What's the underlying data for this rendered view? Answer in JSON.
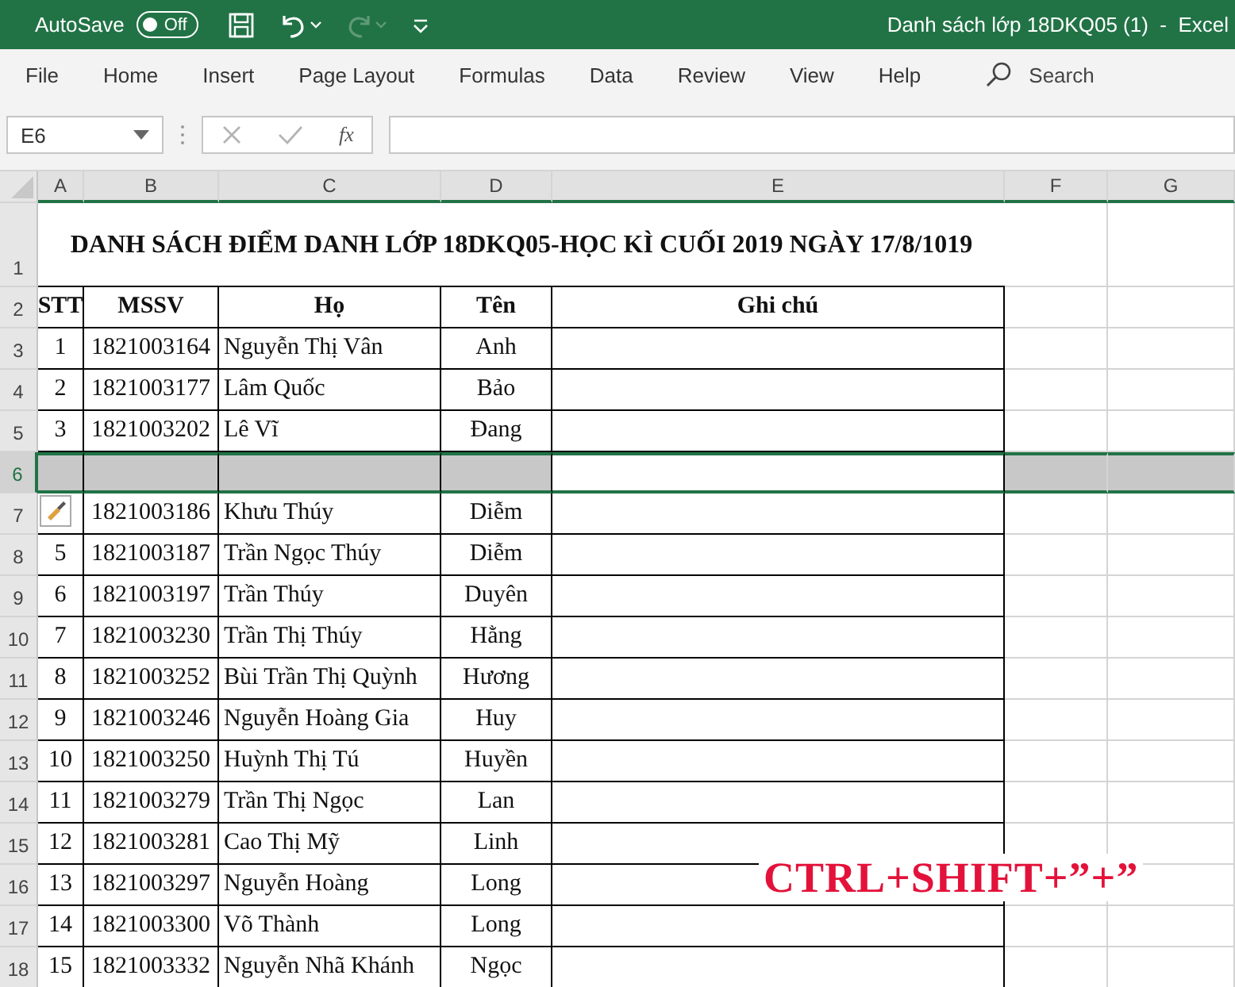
{
  "title_bar": {
    "autosave_label": "AutoSave",
    "autosave_on": false,
    "toggle_text": "Off",
    "document_title": "Danh sách lớp 18DKQ05 (1)  -  Excel",
    "redo_disabled": true
  },
  "ribbon_tabs": [
    {
      "label": "File",
      "selected": false
    },
    {
      "label": "Home",
      "selected": false
    },
    {
      "label": "Insert",
      "selected": false
    },
    {
      "label": "Page Layout",
      "selected": false
    },
    {
      "label": "Formulas",
      "selected": false
    },
    {
      "label": "Data",
      "selected": false
    },
    {
      "label": "Review",
      "selected": false
    },
    {
      "label": "View",
      "selected": false
    },
    {
      "label": "Help",
      "selected": false
    }
  ],
  "search_label": "Search",
  "formula_bar": {
    "name_box": "E6",
    "fx_label": "fx"
  },
  "sheet": {
    "columns": [
      {
        "label": "A",
        "highlighted": true,
        "active": false
      },
      {
        "label": "B",
        "highlighted": true,
        "active": false
      },
      {
        "label": "C",
        "highlighted": true,
        "active": false
      },
      {
        "label": "D",
        "highlighted": true,
        "active": false
      },
      {
        "label": "E",
        "highlighted": true,
        "active": true
      },
      {
        "label": "F",
        "highlighted": true,
        "active": false
      },
      {
        "label": "G",
        "highlighted": true,
        "active": false
      }
    ],
    "title_row": {
      "number": "1",
      "text": "DANH SÁCH ĐIỂM DANH LỚP 18DKQ05-HỌC KÌ CUỐI 2019 NGÀY 17/8/1019"
    },
    "header_row": {
      "number": "2",
      "cells": [
        "STT",
        "MSSV",
        "Họ",
        "Tên",
        "Ghi chú"
      ]
    },
    "rows": [
      {
        "number": "3",
        "stt": "1",
        "mssv": "1821003164",
        "ho": "Nguyễn Thị Vân",
        "ten": "Anh",
        "selected": false
      },
      {
        "number": "4",
        "stt": "2",
        "mssv": "1821003177",
        "ho": "Lâm Quốc",
        "ten": "Bảo",
        "selected": false
      },
      {
        "number": "5",
        "stt": "3",
        "mssv": "1821003202",
        "ho": "Lê Vĩ",
        "ten": "Đang",
        "selected": false
      },
      {
        "number": "6",
        "selected": true
      },
      {
        "number": "7",
        "paste_options": true,
        "mssv": "1821003186",
        "ho": "Khưu Thúy",
        "ten": "Diễm",
        "selected": false
      },
      {
        "number": "8",
        "stt": "5",
        "mssv": "1821003187",
        "ho": "Trần Ngọc Thúy",
        "ten": "Diễm",
        "selected": false
      },
      {
        "number": "9",
        "stt": "6",
        "mssv": "1821003197",
        "ho": "Trần Thúy",
        "ten": "Duyên",
        "selected": false
      },
      {
        "number": "10",
        "stt": "7",
        "mssv": "1821003230",
        "ho": "Trần Thị Thúy",
        "ten": "Hằng",
        "selected": false
      },
      {
        "number": "11",
        "stt": "8",
        "mssv": "1821003252",
        "ho": "Bùi Trần Thị Quỳnh",
        "ten": "Hương",
        "selected": false
      },
      {
        "number": "12",
        "stt": "9",
        "mssv": "1821003246",
        "ho": "Nguyễn Hoàng Gia",
        "ten": "Huy",
        "selected": false
      },
      {
        "number": "13",
        "stt": "10",
        "mssv": "1821003250",
        "ho": "Huỳnh Thị Tú",
        "ten": "Huyền",
        "selected": false
      },
      {
        "number": "14",
        "stt": "11",
        "mssv": "1821003279",
        "ho": "Trần Thị Ngọc",
        "ten": "Lan",
        "selected": false
      },
      {
        "number": "15",
        "stt": "12",
        "mssv": "1821003281",
        "ho": "Cao Thị Mỹ",
        "ten": "Linh",
        "selected": false
      },
      {
        "number": "16",
        "stt": "13",
        "mssv": "1821003297",
        "ho": "Nguyễn Hoàng",
        "ten": "Long",
        "selected": false
      },
      {
        "number": "17",
        "stt": "14",
        "mssv": "1821003300",
        "ho": "Võ Thành",
        "ten": "Long",
        "selected": false
      },
      {
        "number": "18",
        "stt": "15",
        "mssv": "1821003332",
        "ho": "Nguyễn Nhã Khánh",
        "ten": "Ngọc",
        "selected": false
      }
    ]
  },
  "annotation": "CTRL+SHIFT+”+”"
}
